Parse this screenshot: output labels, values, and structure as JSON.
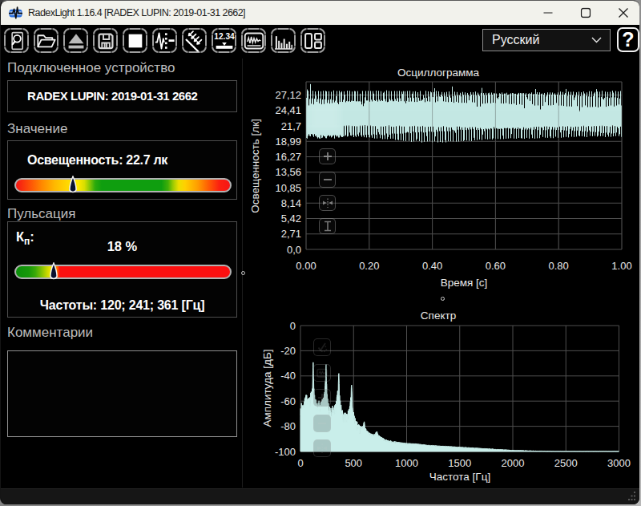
{
  "window": {
    "title": "RadexLight 1.16.4 [RADEX LUPIN: 2019-01-31 2662]",
    "controls": {
      "minimize": "minimize",
      "maximize": "maximize",
      "close": "close"
    }
  },
  "toolbar": {
    "buttons": [
      {
        "name": "preview"
      },
      {
        "name": "open"
      },
      {
        "name": "eject"
      },
      {
        "name": "save"
      },
      {
        "name": "stop"
      },
      {
        "name": "pulse-marker"
      },
      {
        "name": "incident-light"
      },
      {
        "name": "numeric-display",
        "label": "12.34"
      },
      {
        "name": "oscillogram-view"
      },
      {
        "name": "spectrum-view"
      },
      {
        "name": "layout"
      }
    ],
    "language": {
      "value": "Русский"
    },
    "help_label": "?"
  },
  "panels": {
    "device": {
      "heading": "Подключенное устройство",
      "value": "RADEX LUPIN: 2019-01-31 2662"
    },
    "value": {
      "heading": "Значение",
      "label": "Освещенность: 22.7 лк",
      "marker_fraction": 0.26,
      "gradient": [
        {
          "pos": 0,
          "color": "#f51515"
        },
        {
          "pos": 6,
          "color": "#fd4c08"
        },
        {
          "pos": 12,
          "color": "#ff8800"
        },
        {
          "pos": 18,
          "color": "#ffb800"
        },
        {
          "pos": 24,
          "color": "#ffd800"
        },
        {
          "pos": 29,
          "color": "#ffe800"
        },
        {
          "pos": 32,
          "color": "#d8de00"
        },
        {
          "pos": 34.5,
          "color": "#84c606"
        },
        {
          "pos": 37,
          "color": "#2aaa0c"
        },
        {
          "pos": 40,
          "color": "#0f9e0f"
        },
        {
          "pos": 68,
          "color": "#0f9e0f"
        },
        {
          "pos": 71,
          "color": "#3fae08"
        },
        {
          "pos": 73.5,
          "color": "#a0cc02"
        },
        {
          "pos": 76,
          "color": "#ecdf00"
        },
        {
          "pos": 79,
          "color": "#ffd000"
        },
        {
          "pos": 85,
          "color": "#ff9c00"
        },
        {
          "pos": 90,
          "color": "#ff5c04"
        },
        {
          "pos": 95,
          "color": "#fb2010"
        },
        {
          "pos": 100,
          "color": "#f51515"
        }
      ]
    },
    "pulsation": {
      "heading": "Пульсация",
      "kp_base": "К",
      "kp_sub": "п",
      "kp_colon": ":",
      "value": "18 %",
      "marker_fraction": 0.168,
      "frequencies": "Частоты: 120; 241; 361 [Гц]",
      "gradient": [
        {
          "pos": 0,
          "color": "#0b8f0b"
        },
        {
          "pos": 6,
          "color": "#18990a"
        },
        {
          "pos": 9,
          "color": "#3aaa08"
        },
        {
          "pos": 12,
          "color": "#84c303"
        },
        {
          "pos": 14.5,
          "color": "#c8d800"
        },
        {
          "pos": 16.5,
          "color": "#f8ea00"
        },
        {
          "pos": 18,
          "color": "#ffd800"
        },
        {
          "pos": 19,
          "color": "#ff7a00"
        },
        {
          "pos": 20.5,
          "color": "#fb1010"
        },
        {
          "pos": 100,
          "color": "#fb1010"
        }
      ]
    },
    "comments": {
      "heading": "Комментарии",
      "value": ""
    }
  },
  "chart_data": [
    {
      "type": "line",
      "id": "oscillogram",
      "title": "Осциллограмма",
      "xlabel": "Время [с]",
      "ylabel": "Освещенность [лк]",
      "xlim": [
        0,
        1
      ],
      "ylim": [
        0,
        29.35
      ],
      "x_ticks": [
        "0.00",
        "0.20",
        "0.40",
        "0.60",
        "0.80",
        "1.00"
      ],
      "x_tick_values": [
        0,
        0.2,
        0.4,
        0.6,
        0.8,
        1.0
      ],
      "y_ticks": [
        "0,0",
        "2,71",
        "5,42",
        "8,14",
        "10,85",
        "13,56",
        "16,27",
        "18,99",
        "21,7",
        "24,41",
        "27,12"
      ],
      "y_tick_values": [
        0,
        2.712,
        5.424,
        8.136,
        10.848,
        13.56,
        16.272,
        18.984,
        21.696,
        24.408,
        27.12
      ],
      "signal": {
        "kind": "flicker",
        "mean_lux": 22.7,
        "min_lux": 18.78,
        "max_lux": 27.95,
        "duration_s": 1.0,
        "ripple": {
          "hz": 361,
          "amp": 3.0,
          "phase": 2.3
        },
        "dips": [
          {
            "hz": 120,
            "depth": 2.9,
            "sharpness": 0.8,
            "phase": 0.0
          },
          {
            "hz": 241,
            "depth": 1.4,
            "sharpness": 0.7,
            "phase": 1.1
          }
        ]
      }
    },
    {
      "type": "area",
      "id": "spectrum",
      "title": "Спектр",
      "xlabel": "Частота [Гц]",
      "ylabel": "Амплитуда [дБ]",
      "xlim": [
        0,
        3000
      ],
      "ylim": [
        -100,
        0
      ],
      "x_ticks": [
        "0",
        "500",
        "1000",
        "1500",
        "2000",
        "2500",
        "3000"
      ],
      "x_tick_values": [
        0,
        500,
        1000,
        1500,
        2000,
        2500,
        3000
      ],
      "y_ticks": [
        "0",
        "-20",
        "-40",
        "-60",
        "-80",
        "-100"
      ],
      "y_tick_values": [
        0,
        -20,
        -40,
        -60,
        -80,
        -100
      ],
      "peaks_hz": [
        120,
        241,
        361,
        481,
        601,
        721
      ],
      "points": [
        [
          0,
          -66
        ],
        [
          8,
          -63
        ],
        [
          16,
          -64
        ],
        [
          25,
          -61
        ],
        [
          33,
          -62
        ],
        [
          40,
          -57
        ],
        [
          48,
          -55
        ],
        [
          55,
          -54
        ],
        [
          62,
          -56
        ],
        [
          70,
          -58
        ],
        [
          80,
          -57
        ],
        [
          90,
          -58
        ],
        [
          100,
          -54
        ],
        [
          106,
          -50
        ],
        [
          112,
          -47
        ],
        [
          117,
          -36
        ],
        [
          120,
          -29
        ],
        [
          123,
          -38
        ],
        [
          128,
          -52
        ],
        [
          135,
          -57
        ],
        [
          142,
          -60
        ],
        [
          150,
          -61
        ],
        [
          158,
          -63
        ],
        [
          166,
          -62
        ],
        [
          174,
          -61
        ],
        [
          182,
          -63
        ],
        [
          192,
          -62
        ],
        [
          202,
          -60
        ],
        [
          212,
          -59
        ],
        [
          222,
          -55
        ],
        [
          230,
          -50
        ],
        [
          236,
          -43
        ],
        [
          239,
          -35
        ],
        [
          241,
          -28.5
        ],
        [
          245,
          -42
        ],
        [
          250,
          -54
        ],
        [
          258,
          -60
        ],
        [
          266,
          -64
        ],
        [
          274,
          -66
        ],
        [
          282,
          -65
        ],
        [
          290,
          -66
        ],
        [
          300,
          -65
        ],
        [
          312,
          -66
        ],
        [
          324,
          -64
        ],
        [
          336,
          -61
        ],
        [
          346,
          -56
        ],
        [
          354,
          -50
        ],
        [
          358,
          -44
        ],
        [
          361,
          -36.5
        ],
        [
          365,
          -47
        ],
        [
          370,
          -56
        ],
        [
          378,
          -62
        ],
        [
          386,
          -66
        ],
        [
          395,
          -68
        ],
        [
          405,
          -70
        ],
        [
          415,
          -71
        ],
        [
          425,
          -70
        ],
        [
          435,
          -71
        ],
        [
          445,
          -69
        ],
        [
          455,
          -66
        ],
        [
          465,
          -63
        ],
        [
          472,
          -60
        ],
        [
          478,
          -50
        ],
        [
          481,
          -46
        ],
        [
          485,
          -52
        ],
        [
          492,
          -66
        ],
        [
          500,
          -70
        ],
        [
          510,
          -74
        ],
        [
          522,
          -76
        ],
        [
          535,
          -78
        ],
        [
          550,
          -79
        ],
        [
          565,
          -80
        ],
        [
          580,
          -81
        ],
        [
          592,
          -79
        ],
        [
          601,
          -76
        ],
        [
          608,
          -81
        ],
        [
          620,
          -83
        ],
        [
          640,
          -85
        ],
        [
          660,
          -86
        ],
        [
          680,
          -87
        ],
        [
          700,
          -86.5
        ],
        [
          714,
          -85
        ],
        [
          721,
          -84
        ],
        [
          730,
          -87
        ],
        [
          745,
          -88
        ],
        [
          770,
          -89.5
        ],
        [
          800,
          -91
        ],
        [
          850,
          -91.8
        ],
        [
          900,
          -92.5
        ],
        [
          950,
          -93
        ],
        [
          1000,
          -93.5
        ],
        [
          1100,
          -94
        ],
        [
          1200,
          -95
        ],
        [
          1300,
          -95.5
        ],
        [
          1400,
          -96
        ],
        [
          1500,
          -96.5
        ],
        [
          1600,
          -97
        ],
        [
          1700,
          -97.5
        ],
        [
          1800,
          -98
        ],
        [
          1900,
          -98.5
        ],
        [
          2000,
          -99
        ],
        [
          2200,
          -99.5
        ],
        [
          2400,
          -100
        ],
        [
          2600,
          -100
        ],
        [
          2800,
          -100
        ],
        [
          3000,
          -100
        ]
      ]
    }
  ],
  "colors": {
    "trace": "#c9eeea",
    "grid": "#4f4f4f",
    "tick_text": "#e8e8e8",
    "titlebar_bg": "#f2f2ec",
    "window_bg": "#000000"
  }
}
